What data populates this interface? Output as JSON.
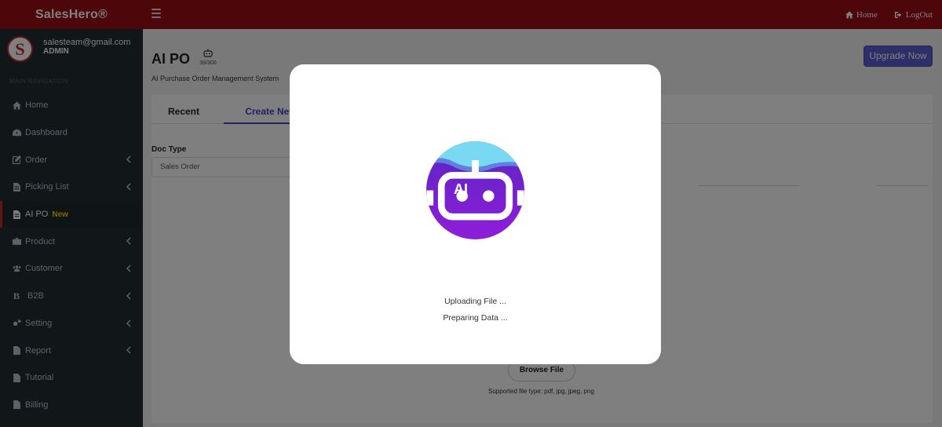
{
  "header": {
    "brand": "SalesHero®",
    "nav": [
      {
        "label": "Home",
        "icon": "home-icon"
      },
      {
        "label": "LogOut",
        "icon": "logout-icon"
      }
    ]
  },
  "user": {
    "email": "salesteam@gmail.com",
    "role": "ADMIN",
    "logo_letter": "S"
  },
  "sidebar": {
    "section_header": "MAIN NAVIGATION",
    "items": [
      {
        "label": "Home",
        "icon": "home-icon"
      },
      {
        "label": "Dashboard",
        "icon": "dashboard-icon"
      },
      {
        "label": "Order",
        "icon": "edit-icon",
        "expandable": true
      },
      {
        "label": "Picking List",
        "icon": "document-icon",
        "expandable": true
      },
      {
        "label": "AI PO",
        "icon": "file-text-icon",
        "badge": "New",
        "active": true
      },
      {
        "label": "Product",
        "icon": "briefcase-icon",
        "expandable": true
      },
      {
        "label": "Customer",
        "icon": "users-icon",
        "expandable": true
      },
      {
        "label": "B2B",
        "icon": "b2b-icon",
        "icon_letter": "B",
        "expandable": true
      },
      {
        "label": "Setting",
        "icon": "cogs-icon",
        "expandable": true
      },
      {
        "label": "Report",
        "icon": "report-icon",
        "expandable": true
      },
      {
        "label": "Tutorial",
        "icon": "tutorial-icon"
      },
      {
        "label": "Billing",
        "icon": "billing-icon"
      }
    ]
  },
  "page": {
    "title": "AI PO",
    "counter": "39/300",
    "subtitle": "AI Purchase Order Management System",
    "upgrade_label": "Upgrade Now"
  },
  "tabs": {
    "recent": "Recent",
    "create_new": "Create New"
  },
  "form": {
    "doc_type_label": "Doc Type",
    "doc_type_value": "Sales Order",
    "browse_label": "Browse File",
    "supported_types": "Supported file type: pdf, jpg, jpeg, png"
  },
  "modal": {
    "ai_label": "AI",
    "status_lines": [
      "Uploading File ...",
      "Preparing Data ..."
    ],
    "colors": {
      "circle_top": "#7ad9f2",
      "circle_mid": "#6b22c9",
      "circle_bottom": "#8a1fd6"
    }
  },
  "colors": {
    "header_bg": "#9b0f16",
    "sidebar_bg": "#222d32",
    "accent": "#5d5dd1",
    "new_badge": "#f3d100"
  }
}
